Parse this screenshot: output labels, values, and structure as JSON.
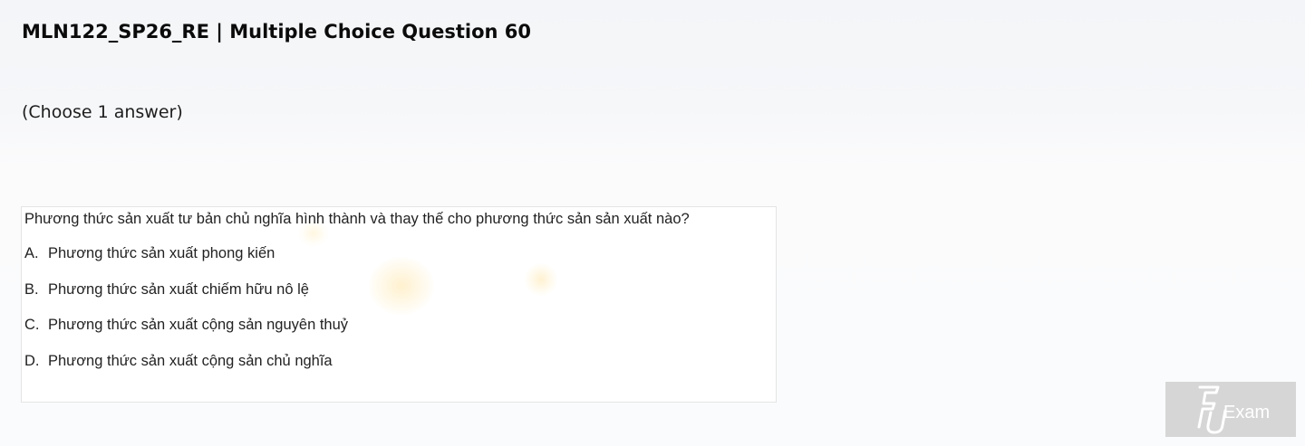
{
  "header": {
    "title": "MLN122_SP26_RE | Multiple Choice Question 60",
    "instruction": "(Choose 1 answer)"
  },
  "question": {
    "text": "Phương thức sản xuất tư bản chủ nghĩa hình thành và thay thế cho phương thức sản sản xuất nào?",
    "options": [
      {
        "letter": "A.",
        "text": "Phương thức sản xuất phong kiến"
      },
      {
        "letter": "B.",
        "text": "Phương thức sản xuất chiếm hữu nô lệ"
      },
      {
        "letter": "C.",
        "text": "Phương thức sản xuất cộng sản nguyên thuỷ"
      },
      {
        "letter": "D.",
        "text": "Phương thức sản xuất cộng sản chủ nghĩa"
      }
    ]
  },
  "logo": {
    "text": "FU Exam",
    "background_color": "#d6d6d6",
    "foreground_color": "#ffffff"
  }
}
